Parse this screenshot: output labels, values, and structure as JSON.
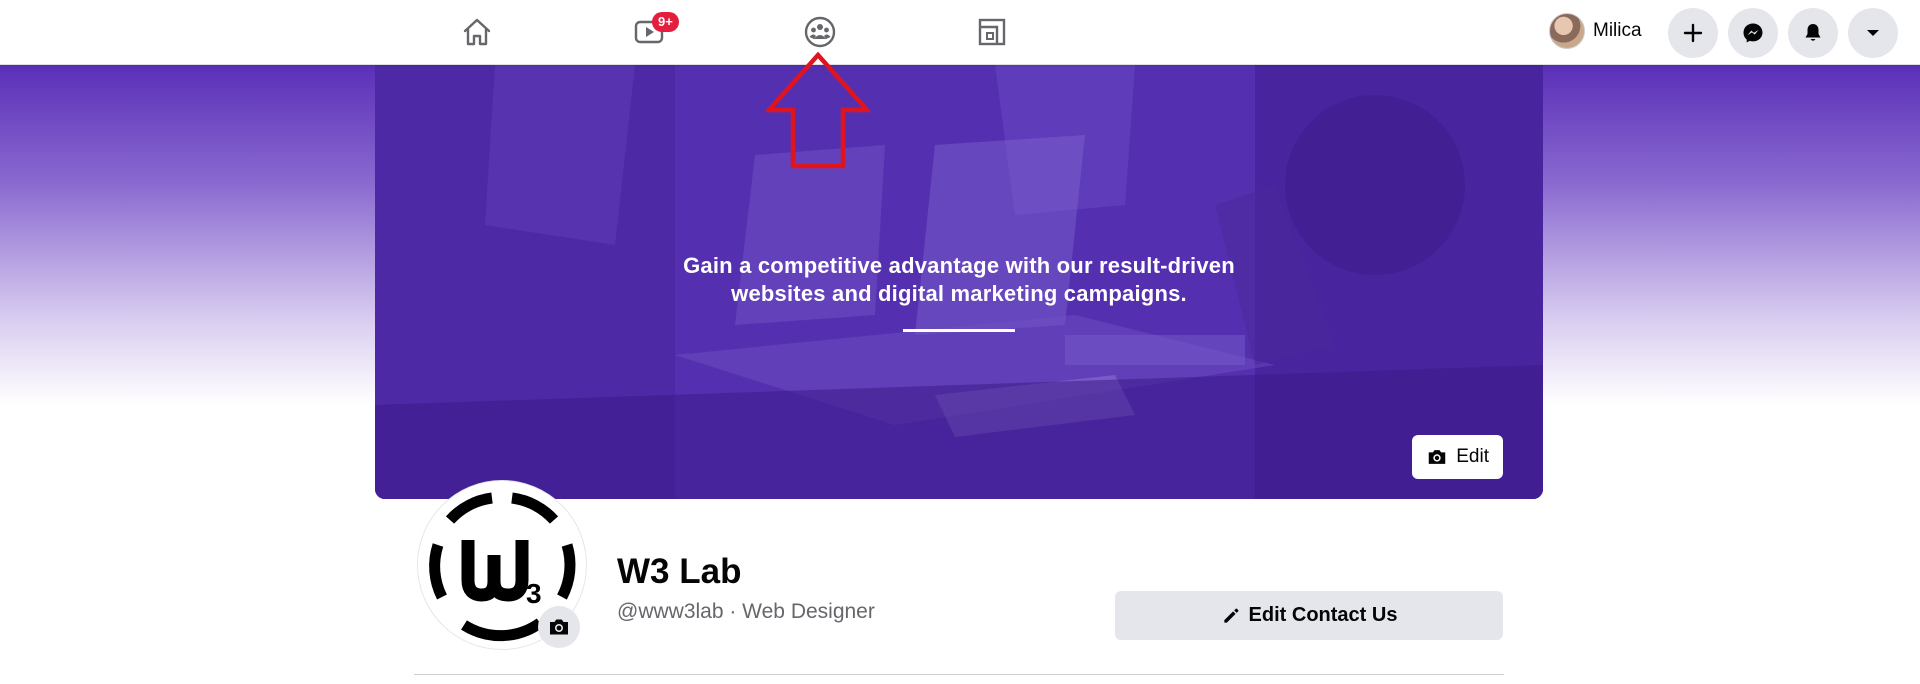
{
  "nav": {
    "tabs": [
      {
        "name": "home",
        "icon": "home-icon"
      },
      {
        "name": "watch",
        "icon": "video-icon",
        "badge": "9+"
      },
      {
        "name": "groups",
        "icon": "groups-icon"
      },
      {
        "name": "gaming",
        "icon": "gaming-icon"
      }
    ],
    "user_name": "Milica",
    "actions": [
      "plus-icon",
      "messenger-icon",
      "bell-icon",
      "caret-down-icon"
    ]
  },
  "cover": {
    "tagline_line1": "Gain a competitive advantage with our result-driven",
    "tagline_line2": "websites and digital marketing campaigns.",
    "edit_label": "Edit"
  },
  "profile": {
    "name": "W3 Lab",
    "subtitle": "@www3lab · Web Designer",
    "edit_contact_label": "Edit Contact Us"
  },
  "colors": {
    "brand_purple": "#5b30b8",
    "badge_red": "#e41e3f",
    "annotation_red": "#e0141e"
  }
}
